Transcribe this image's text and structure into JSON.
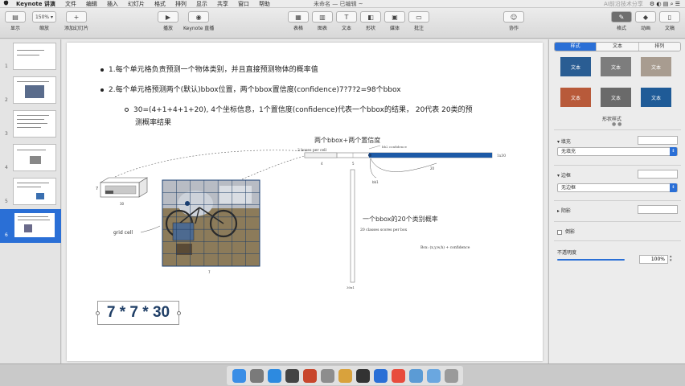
{
  "menubar": {
    "apple": "",
    "items": [
      "Keynote 讲演",
      "文件",
      "编辑",
      "插入",
      "幻灯片",
      "格式",
      "排列",
      "显示",
      "共享",
      "窗口",
      "帮助"
    ],
    "doc_title": "未命名 — 已编辑 ~",
    "watermark": "AI前沿技术分享"
  },
  "toolbar": {
    "left": [
      {
        "icon": "view-icon",
        "label": "显示"
      },
      {
        "icon": "zoom-icon",
        "value": "150% ▾",
        "label": "缩放"
      },
      {
        "icon": "add-slide-icon",
        "value": "+",
        "label": "添加幻灯片"
      }
    ],
    "play_label": "播放",
    "live_label": "Keynote 直播",
    "center": [
      {
        "icon": "table-icon",
        "label": "表格"
      },
      {
        "icon": "chart-icon",
        "label": "图表"
      },
      {
        "icon": "text-icon",
        "label": "文本"
      },
      {
        "icon": "shape-icon",
        "label": "形状"
      },
      {
        "icon": "media-icon",
        "label": "媒体"
      },
      {
        "icon": "comment-icon",
        "label": "批注"
      }
    ],
    "collab_label": "协作",
    "right": [
      {
        "icon": "format-icon",
        "label": "格式"
      },
      {
        "icon": "animate-icon",
        "label": "动画"
      },
      {
        "icon": "document-icon",
        "label": "文稿"
      }
    ]
  },
  "sidebar": {
    "slide_numbers": [
      "1",
      "2",
      "3",
      "4",
      "5",
      "6"
    ],
    "selected": 6
  },
  "slide": {
    "bullet1": "1.每个单元格负责预测一个物体类别，并且直接预测物体的概率值",
    "bullet2": "2.每个单元格预测两个(默认)bbox位置，两个bbox置信度(confidence)7?7?2=98个bbox",
    "sub_bullet_l1": "30=(4+1+4+1+20), 4个坐标信息，1个置信度(confidence)代表一个bbox的结果， 20代表 20类的预",
    "sub_bullet_l2": "测概率结果",
    "diagram": {
      "top_label": "两个bbox+两个置信度",
      "boxes_label": "2 boxes per cell",
      "conf_label": "bb2 confidence",
      "length_label": "1x30",
      "seg1": "4",
      "seg2": "5",
      "seg3": "20",
      "small_label": "bb1",
      "grid_label": "grid cell",
      "s_label_left": "7",
      "s_label_bottom": "30",
      "img_bottom": "7",
      "class_text": "一个bbox的20个类别概率",
      "classes_label": "20 classes scores per box",
      "box_formula": "Box: (x,y,w,h) + confidence",
      "vertical_label": "30x1"
    },
    "formula": "7 * 7 * 30"
  },
  "inspector": {
    "tabs": [
      "样式",
      "文本",
      "排列"
    ],
    "active_tab": 0,
    "style_tiles": [
      {
        "label": "文本",
        "color": "#2a5d93"
      },
      {
        "label": "文本",
        "color": "#7d7d7d"
      },
      {
        "label": "文本",
        "color": "#a89c90"
      },
      {
        "label": "文本",
        "color": "#b85a3a"
      },
      {
        "label": "文本",
        "color": "#6a6a6a"
      },
      {
        "label": "文本",
        "color": "#1f5b97"
      }
    ],
    "style_caption": "形状样式",
    "fill_label": "填充",
    "fill_value": "无填充",
    "border_label": "边框",
    "border_value": "无边框",
    "shadow_label": "阴影",
    "reflection_label": "倒影",
    "opacity_label": "不透明度",
    "opacity_value": "100%"
  },
  "dock": {
    "icons": [
      {
        "name": "finder-icon",
        "color": "#3a8ee6"
      },
      {
        "name": "launchpad-icon",
        "color": "#7a7a7a"
      },
      {
        "name": "safari-icon",
        "color": "#2d8ae0"
      },
      {
        "name": "clock-icon",
        "color": "#444"
      },
      {
        "name": "powerpoint-icon",
        "color": "#c8462c"
      },
      {
        "name": "settings-icon",
        "color": "#8d8d8d"
      },
      {
        "name": "photos-icon",
        "color": "#d9a23c"
      },
      {
        "name": "terminal-icon",
        "color": "#333"
      },
      {
        "name": "keynote-icon",
        "color": "#2a6fd6"
      },
      {
        "name": "calendar-icon",
        "color": "#e84c3d"
      },
      {
        "name": "preview-icon",
        "color": "#5b9bd5"
      },
      {
        "name": "folder-icon",
        "color": "#6aa7e0"
      },
      {
        "name": "trash-icon",
        "color": "#9a9a9a"
      }
    ]
  }
}
